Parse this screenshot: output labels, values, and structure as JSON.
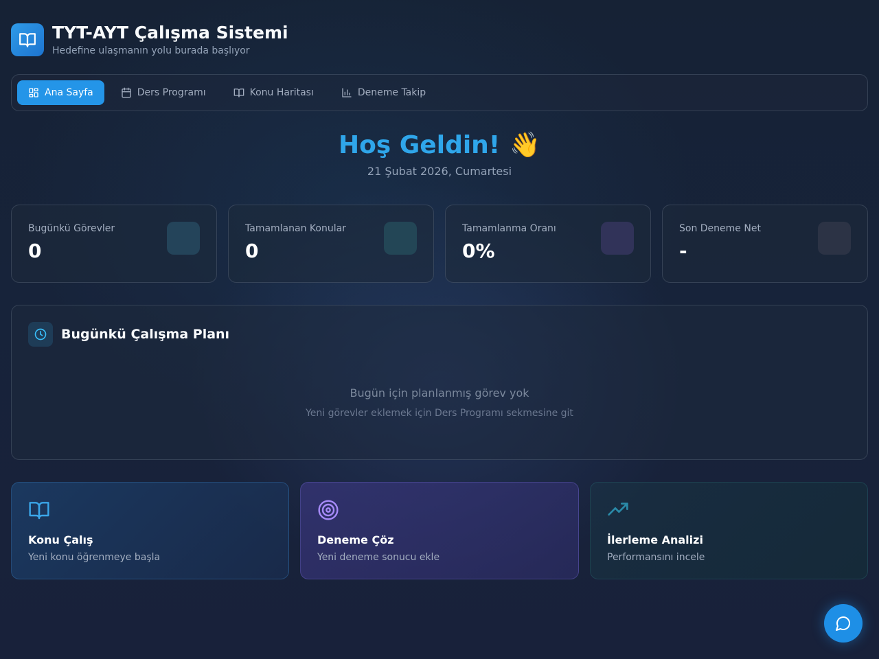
{
  "app": {
    "title": "TYT-AYT Çalışma Sistemi",
    "subtitle": "Hedefine ulaşmanın yolu burada başlıyor",
    "logo_icon": "book-open-icon"
  },
  "nav": {
    "tabs": [
      {
        "label": "Ana Sayfa",
        "icon": "dashboard-icon",
        "active": true
      },
      {
        "label": "Ders Programı",
        "icon": "calendar-icon",
        "active": false
      },
      {
        "label": "Konu Haritası",
        "icon": "book-open-icon",
        "active": false
      },
      {
        "label": "Deneme Takip",
        "icon": "bar-chart-icon",
        "active": false
      }
    ]
  },
  "welcome": {
    "title": "Hoş Geldin!",
    "emoji": "👋",
    "date": "21 Şubat 2026, Cumartesi"
  },
  "stats": [
    {
      "label": "Bugünkü Görevler",
      "value": "0",
      "accent": "#2a4a63"
    },
    {
      "label": "Tamamlanan Konular",
      "value": "0",
      "accent": "#254a5c"
    },
    {
      "label": "Tamamlanma Oranı",
      "value": "0%",
      "accent": "#34345e"
    },
    {
      "label": "Son Deneme Net",
      "value": "-",
      "accent": "#2e3548"
    }
  ],
  "plan": {
    "title": "Bugünkü Çalışma Planı",
    "icon": "clock-icon",
    "empty_message": "Bugün için planlanmış görev yok",
    "empty_hint": "Yeni görevler eklemek için Ders Programı sekmesine git"
  },
  "actions": [
    {
      "title": "Konu Çalış",
      "description": "Yeni konu öğrenmeye başla",
      "icon": "book-open-icon"
    },
    {
      "title": "Deneme Çöz",
      "description": "Yeni deneme sonucu ekle",
      "icon": "target-icon"
    },
    {
      "title": "İlerleme Analizi",
      "description": "Performansını incele",
      "icon": "trending-up-icon"
    }
  ],
  "chat": {
    "icon": "chat-bubble-icon"
  },
  "colors": {
    "primary": "#2495e8",
    "welcome_title": "#2fa6ea",
    "background": "#17233a"
  }
}
